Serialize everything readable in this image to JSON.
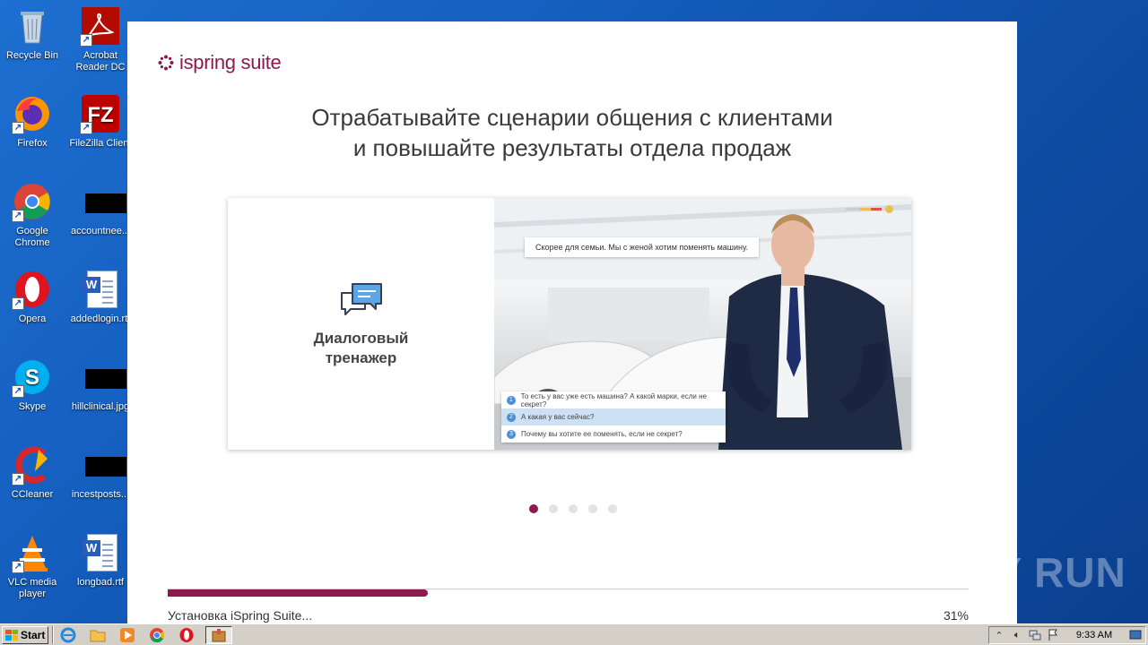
{
  "desktop": {
    "icons": [
      {
        "label": "Recycle Bin"
      },
      {
        "label": "Acrobat Reader DC"
      },
      {
        "label": "Firefox"
      },
      {
        "label": "FileZilla Client"
      },
      {
        "label": "Google Chrome"
      },
      {
        "label": "accountnee..."
      },
      {
        "label": "Opera"
      },
      {
        "label": "addedlogin.rtf"
      },
      {
        "label": "Skype"
      },
      {
        "label": "hillclinical.jpg"
      },
      {
        "label": "CCleaner"
      },
      {
        "label": "incestposts..."
      },
      {
        "label": "VLC media player"
      },
      {
        "label": "longbad.rtf"
      }
    ]
  },
  "installer": {
    "logo_text": "ispring suite",
    "headline_line1": "Отрабатывайте сценарии общения с клиентами",
    "headline_line2": "и повышайте результаты отдела продаж",
    "slide": {
      "title_line1": "Диалоговый",
      "title_line2": "тренажер",
      "bubble": "Скорее для семьи. Мы с женой хотим поменять машину.",
      "answers": [
        {
          "num": "1",
          "text": "То есть у вас уже есть машина? А какой марки, если не секрет?"
        },
        {
          "num": "2",
          "text": "А какая у вас сейчас?"
        },
        {
          "num": "3",
          "text": "Почему вы хотите ее поменять, если не секрет?"
        }
      ],
      "selected_answer_index": 1
    },
    "carousel": {
      "count": 5,
      "active_index": 0
    },
    "progress": {
      "status": "Установка iSpring Suite...",
      "percent_label": "31%",
      "fraction": 0.325
    },
    "brand_color": "#8c1a4f"
  },
  "watermark": "ANY RUN",
  "taskbar": {
    "start_label": "Start",
    "clock": "9:33 AM"
  }
}
